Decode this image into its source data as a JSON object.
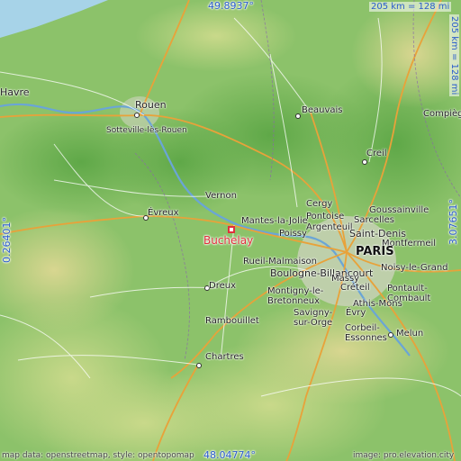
{
  "map": {
    "coords": {
      "top_lat": "49.8937°",
      "bottom_lat": "48.04774°",
      "left_lon": "0.26401°",
      "right_lon": "3.07651°"
    },
    "scale": {
      "horizontal": "205 km = 128 mi",
      "vertical": "205 km = 128 mi"
    },
    "attribution_left": "map data: openstreetmap, style: opentopomap",
    "attribution_right": "image: pro.elevation.city",
    "target_place": "Buchelay",
    "places": {
      "havre": "Havre",
      "rouen": "Rouen",
      "sotteville": "Sotteville-lès-Rouen",
      "beauvais": "Beauvais",
      "compiegne": "Compiègne",
      "creil": "Creil",
      "vernon": "Vernon",
      "evreux": "Évreux",
      "cergy": "Cergy",
      "mantes": "Mantes-la-Jolie",
      "pontoise": "Pontoise",
      "goussainville": "Goussainville",
      "sarcelles": "Sarcelles",
      "poissy": "Poissy",
      "argenteuil": "Argenteuil",
      "saint_denis": "Saint-Denis",
      "montfermeil": "Montfermeil",
      "paris": "PARIS",
      "rueil": "Rueil-Malmaison",
      "noisy": "Noisy-le-Grand",
      "boulogne": "Boulogne-Billancourt",
      "dreux": "Dreux",
      "montigny": "Montigny-le-Bretonneux",
      "massy": "Massy",
      "creteil": "Créteil",
      "pontault": "Pontault-Combault",
      "athis": "Athis-Mons",
      "savigny": "Savigny-sur-Orge",
      "evry": "Évry",
      "rambouillet": "Rambouillet",
      "corbeil": "Corbeil-Essonnes",
      "melun": "Melun",
      "chartres": "Chartres"
    }
  }
}
